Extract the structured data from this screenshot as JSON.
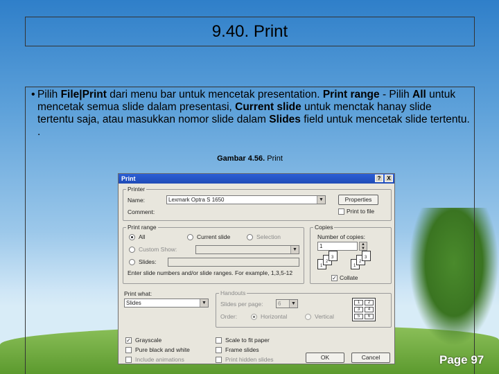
{
  "slide": {
    "title": "9.40. Print",
    "bullet": "•",
    "body_segments": [
      {
        "t": "Pilih ",
        "b": false
      },
      {
        "t": "File|Print",
        "b": true
      },
      {
        "t": " dari menu bar untuk mencetak presentation.  ",
        "b": false
      },
      {
        "t": "Print range",
        "b": true
      },
      {
        "t": " - Pilih ",
        "b": false
      },
      {
        "t": "All",
        "b": true
      },
      {
        "t": " untuk mencetak semua slide dalam presentasi, ",
        "b": false
      },
      {
        "t": "Current slide",
        "b": true
      },
      {
        "t": " untuk menctak hanay slide tertentu saja, atau masukkan nomor slide dalam ",
        "b": false
      },
      {
        "t": "Slides",
        "b": true
      },
      {
        "t": " field untuk mencetak slide tertentu. .",
        "b": false
      }
    ],
    "caption_bold": "Gambar 4.56.",
    "caption_rest": " Print",
    "page_label": "Page 97"
  },
  "dialog": {
    "title": "Print",
    "help_btn": "?",
    "close_btn": "X",
    "printer_group": "Printer",
    "name_label": "Name:",
    "name_value": "Lexmark Optra S 1650",
    "comment_label": "Comment:",
    "properties_btn": "Properties",
    "print_to_file": "Print to file",
    "print_range_group": "Print range",
    "range_all": "All",
    "range_current": "Current slide",
    "range_selection": "Selection",
    "range_custom": "Custom Show:",
    "range_slides": "Slides:",
    "range_hint": "Enter slide numbers and/or slide ranges. For example, 1,3,5-12",
    "copies_group": "Copies",
    "num_copies_label": "Number of copies:",
    "num_copies_value": "1",
    "collate": "Collate",
    "print_what_label": "Print what:",
    "print_what_value": "Slides",
    "handouts_group": "Handouts",
    "slides_per_page_label": "Slides per page:",
    "slides_per_page_value": "6",
    "order_label": "Order:",
    "order_horizontal": "Horizontal",
    "order_vertical": "Vertical",
    "grayscale": "Grayscale",
    "pure_bw": "Pure black and white",
    "include_animations": "Include animations",
    "scale_to_fit": "Scale to fit paper",
    "frame_slides": "Frame slides",
    "print_hidden": "Print hidden slides",
    "ok_btn": "OK",
    "cancel_btn": "Cancel",
    "handout_nums": [
      "1",
      "2",
      "3",
      "4",
      "5",
      "6"
    ],
    "collate_pages": [
      "1",
      "2",
      "3"
    ]
  }
}
